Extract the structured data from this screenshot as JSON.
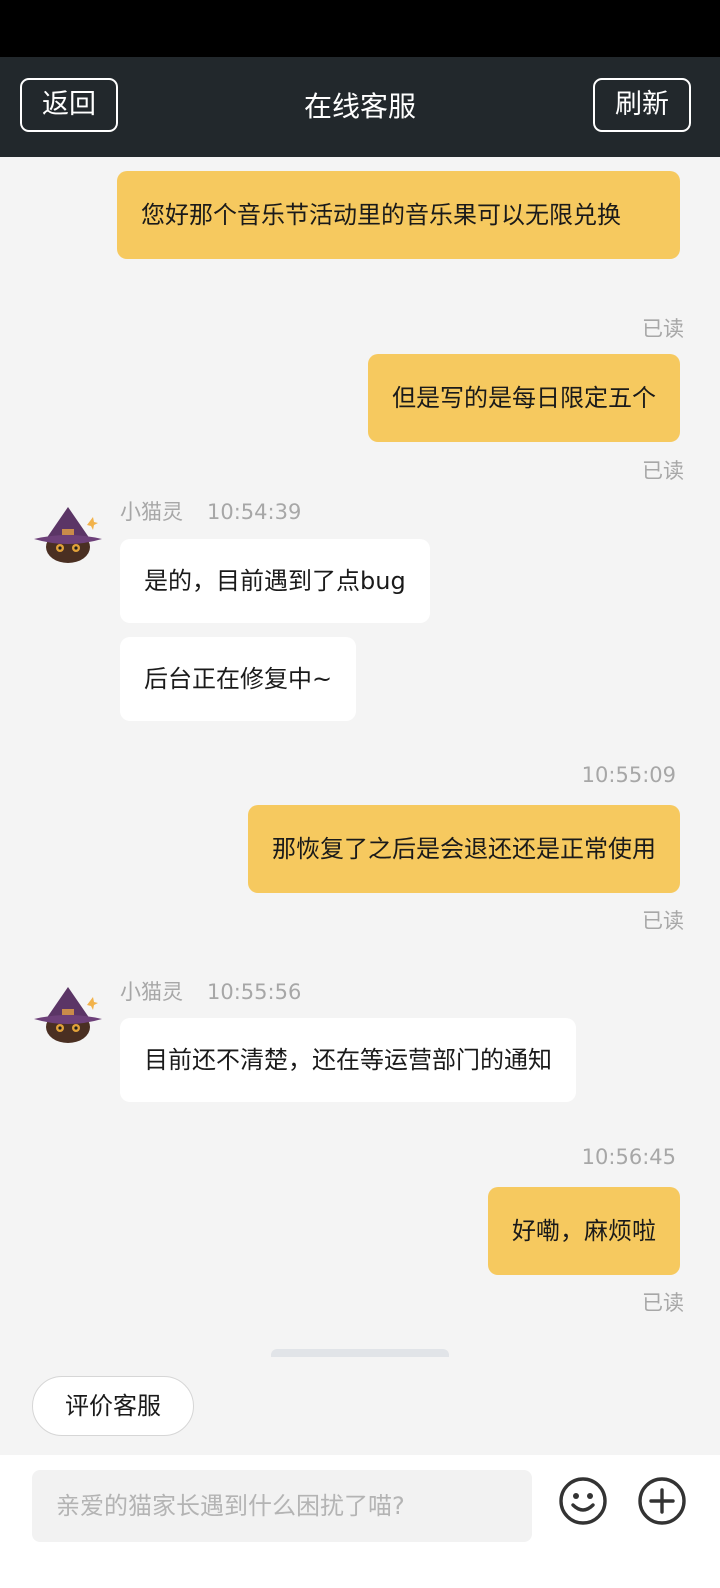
{
  "header": {
    "back_label": "返回",
    "title": "在线客服",
    "refresh_label": "刷新"
  },
  "messages": [
    {
      "from": "user",
      "text": "您好那个音乐节活动里的音乐果可以无限兑换",
      "status": "已读"
    },
    {
      "from": "user",
      "text": "但是写的是每日限定五个",
      "status": "已读"
    },
    {
      "from": "agent",
      "name": "小猫灵",
      "time": "10:54:39",
      "texts": [
        "是的，目前遇到了点bug",
        "后台正在修复中~"
      ]
    },
    {
      "from": "user",
      "time": "10:55:09",
      "text": "那恢复了之后是会退还还是正常使用",
      "status": "已读"
    },
    {
      "from": "agent",
      "name": "小猫灵",
      "time": "10:55:56",
      "texts": [
        "目前还不清楚，还在等运营部门的通知"
      ]
    },
    {
      "from": "user",
      "time": "10:56:45",
      "text": "好嘞，麻烦啦",
      "status": "已读"
    }
  ],
  "rate_button_label": "评价客服",
  "composer": {
    "placeholder": "亲爱的猫家长遇到什么困扰了喵?",
    "emoji_icon": "smiley-icon",
    "add_icon": "plus-circle-icon"
  },
  "colors": {
    "header_bg": "#22282c",
    "user_bubble": "#f6c95f",
    "agent_bubble": "#ffffff",
    "chat_bg": "#f4f4f4"
  }
}
